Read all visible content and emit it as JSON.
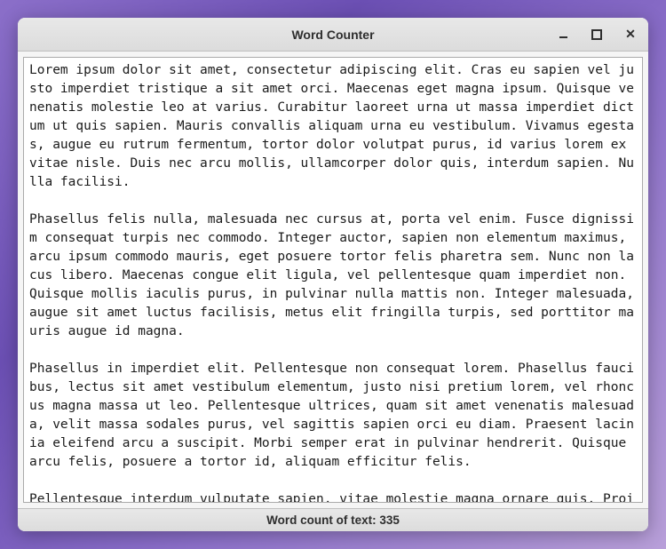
{
  "window": {
    "title": "Word Counter"
  },
  "text": {
    "content": "Lorem ipsum dolor sit amet, consectetur adipiscing elit. Cras eu sapien vel justo imperdiet tristique a sit amet orci. Maecenas eget magna ipsum. Quisque venenatis molestie leo at varius. Curabitur laoreet urna ut massa imperdiet dictum ut quis sapien. Mauris convallis aliquam urna eu vestibulum. Vivamus egestas, augue eu rutrum fermentum, tortor dolor volutpat purus, id varius lorem ex vitae nisle. Duis nec arcu mollis, ullamcorper dolor quis, interdum sapien. Nulla facilisi.\n\nPhasellus felis nulla, malesuada nec cursus at, porta vel enim. Fusce dignissim consequat turpis nec commodo. Integer auctor, sapien non elementum maximus, arcu ipsum commodo mauris, eget posuere tortor felis pharetra sem. Nunc non lacus libero. Maecenas congue elit ligula, vel pellentesque quam imperdiet non. Quisque mollis iaculis purus, in pulvinar nulla mattis non. Integer malesuada, augue sit amet luctus facilisis, metus elit fringilla turpis, sed porttitor mauris augue id magna.\n\nPhasellus in imperdiet elit. Pellentesque non consequat lorem. Phasellus faucibus, lectus sit amet vestibulum elementum, justo nisi pretium lorem, vel rhoncus magna massa ut leo. Pellentesque ultrices, quam sit amet venenatis malesuada, velit massa sodales purus, vel sagittis sapien orci eu diam. Praesent lacinia eleifend arcu a suscipit. Morbi semper erat in pulvinar hendrerit. Quisque arcu felis, posuere a tortor id, aliquam efficitur felis.\n\nPellentesque interdum vulputate sapien, vitae molestie magna ornare quis. Proin"
  },
  "status": {
    "label": "Word count of text:",
    "count": 335
  }
}
